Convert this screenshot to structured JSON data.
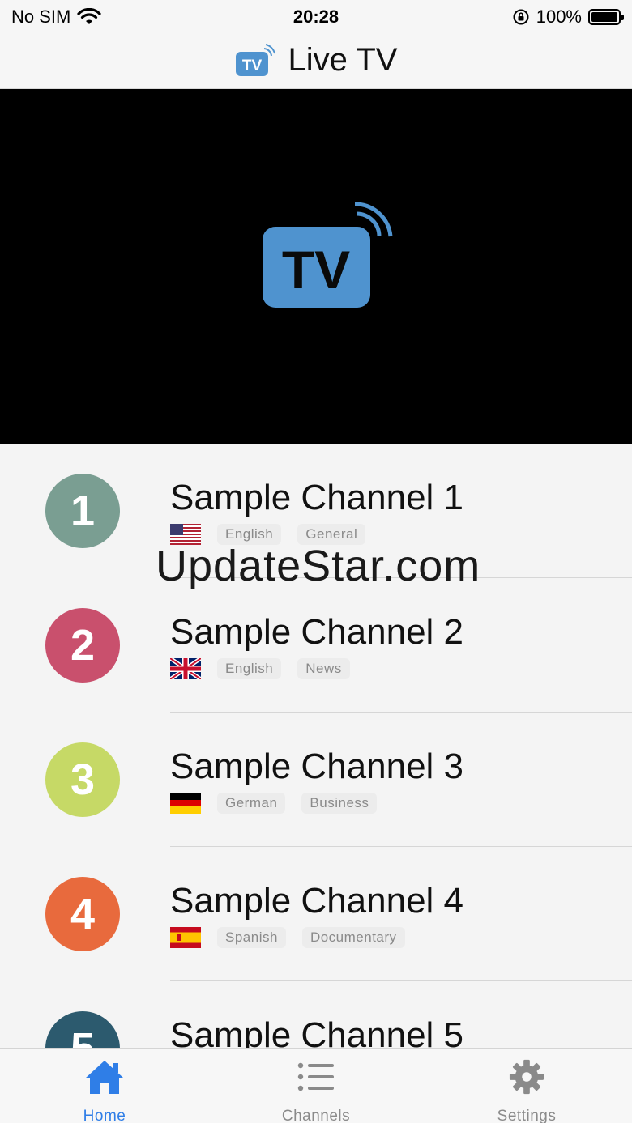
{
  "status": {
    "carrier": "No SIM",
    "time": "20:28",
    "battery": "100%"
  },
  "header": {
    "title": "Live TV",
    "logo_text": "TV"
  },
  "player": {
    "logo_text": "TV"
  },
  "channels": [
    {
      "number": "1",
      "name": "Sample Channel 1",
      "language": "English",
      "category": "General",
      "color": "#7a9e92",
      "flag": "us"
    },
    {
      "number": "2",
      "name": "Sample Channel 2",
      "language": "English",
      "category": "News",
      "color": "#c9506d",
      "flag": "gb"
    },
    {
      "number": "3",
      "name": "Sample Channel 3",
      "language": "German",
      "category": "Business",
      "color": "#c6d966",
      "flag": "de"
    },
    {
      "number": "4",
      "name": "Sample Channel 4",
      "language": "Spanish",
      "category": "Documentary",
      "color": "#e86a3d",
      "flag": "es"
    },
    {
      "number": "5",
      "name": "Sample Channel 5",
      "language": "",
      "category": "",
      "color": "#2c5a6e",
      "flag": ""
    }
  ],
  "watermark": "UpdateStar.com",
  "tabs": [
    {
      "label": "Home",
      "icon": "home-icon",
      "active": true
    },
    {
      "label": "Channels",
      "icon": "list-icon",
      "active": false
    },
    {
      "label": "Settings",
      "icon": "gear-icon",
      "active": false
    }
  ],
  "colors": {
    "accent": "#2f7ee7",
    "tv_blue": "#4f93cf"
  }
}
